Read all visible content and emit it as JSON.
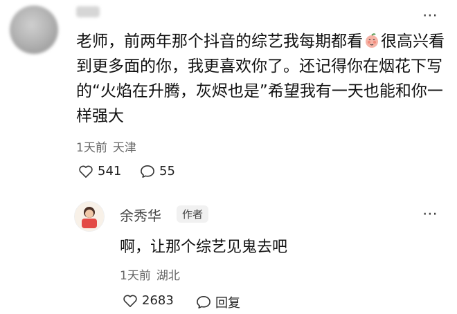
{
  "main_comment": {
    "text_parts": [
      "老师，前两年那个抖音的综艺我每期都看",
      "很高兴看到更多面的你，我更喜欢你了。还记得你在烟花下写的“火焰在升腾，灰烬也是”希望我有一天也能和你一样强大"
    ],
    "emoji": "peach-blush-emoji",
    "time": "1天前",
    "location": "天津",
    "likes": "541",
    "replies": "55"
  },
  "reply": {
    "name": "余秀华",
    "badge": "作者",
    "text": "啊，让那个综艺见鬼去吧",
    "time": "1天前",
    "location": "湖北",
    "likes": "2683",
    "reply_label": "回复"
  },
  "icons": {
    "more": "more-dots-icon",
    "like": "heart-outline-icon",
    "comment": "chat-bubble-icon"
  }
}
